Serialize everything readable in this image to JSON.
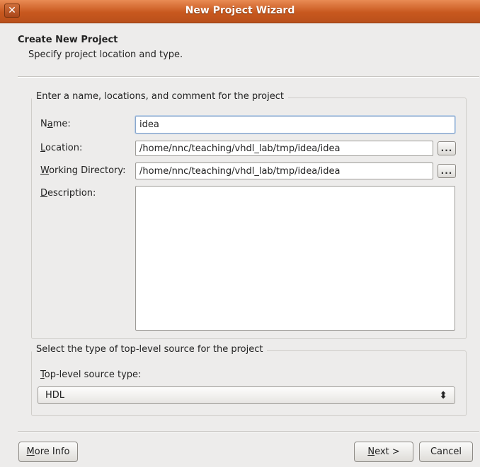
{
  "window": {
    "title": "New Project Wizard",
    "close_glyph": "✕"
  },
  "header": {
    "title": "Create New Project",
    "subtitle": "Specify project location and type."
  },
  "project_group": {
    "legend": "Enter a name, locations, and comment for the project",
    "name": {
      "label_pre": "N",
      "label_u": "a",
      "label_post": "me:",
      "value": "idea"
    },
    "location": {
      "label_pre": "",
      "label_u": "L",
      "label_post": "ocation:",
      "value": "/home/nnc/teaching/vhdl_lab/tmp/idea/idea"
    },
    "working_dir": {
      "label_pre": "",
      "label_u": "W",
      "label_post": "orking Directory:",
      "value": "/home/nnc/teaching/vhdl_lab/tmp/idea/idea"
    },
    "description": {
      "label_pre": "",
      "label_u": "D",
      "label_post": "escription:",
      "value": ""
    },
    "browse_label": "..."
  },
  "source_group": {
    "legend": "Select the type of top-level source for the project",
    "field_label_pre": "",
    "field_label_u": "T",
    "field_label_post": "op-level source type:",
    "selected": "HDL",
    "select_icon": "updown-arrows-icon",
    "select_glyph": "⬍"
  },
  "buttons": {
    "more_info_u": "M",
    "more_info_rest": "ore Info",
    "next_u": "N",
    "next_rest": "ext >",
    "cancel": "Cancel"
  }
}
